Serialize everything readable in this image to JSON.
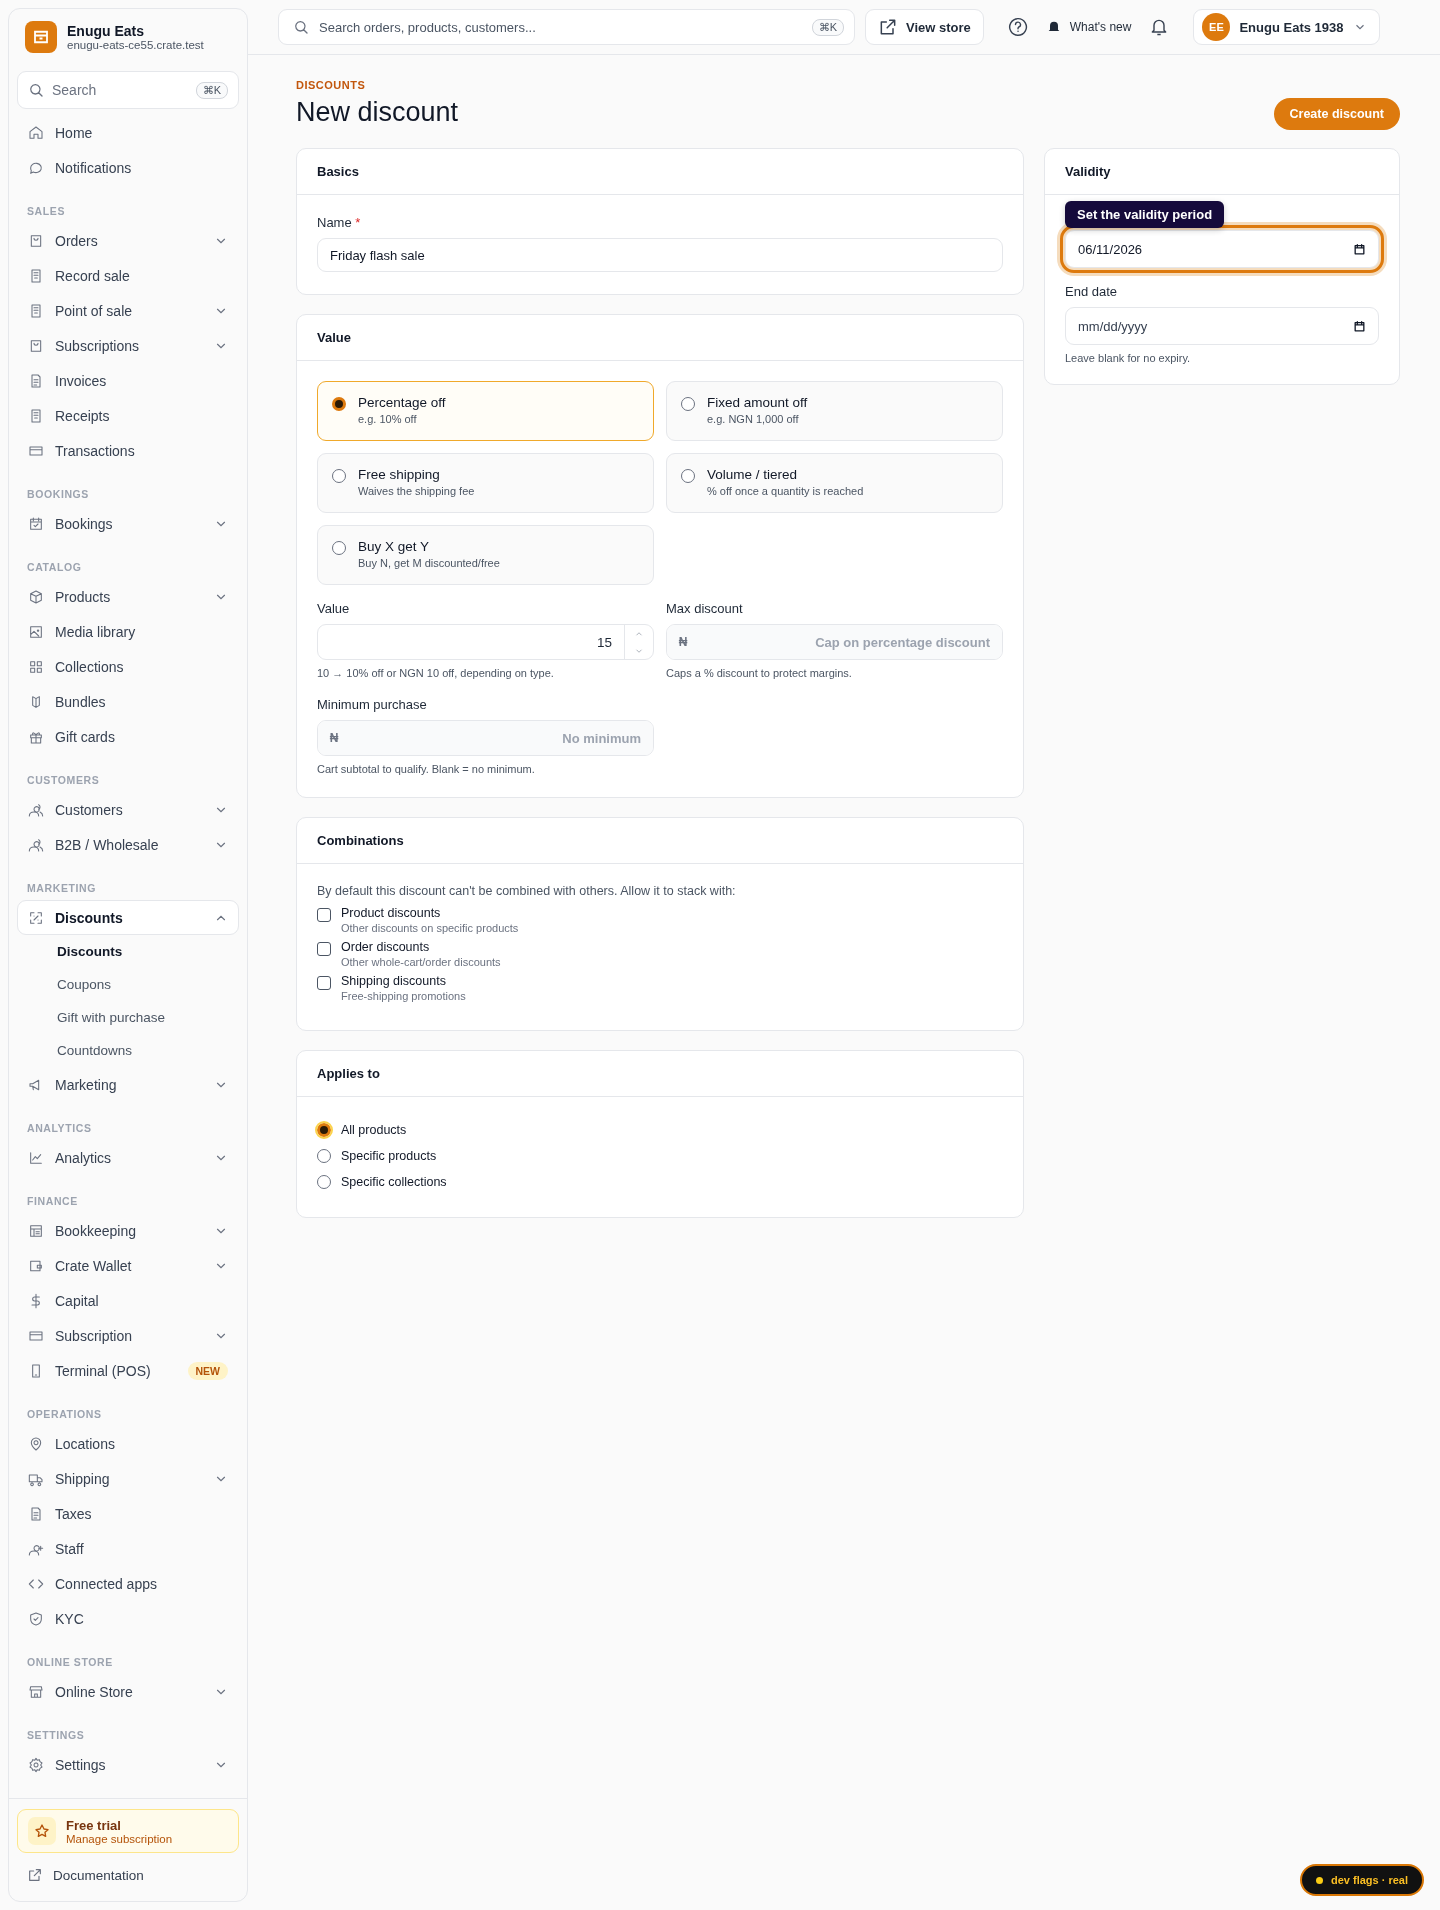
{
  "brand": {
    "name": "Enugu Eats",
    "domain": "enugu-eats-ce55.crate.test"
  },
  "sidebar": {
    "search": {
      "placeholder": "Search",
      "shortcut": "⌘K"
    },
    "sections": [
      {
        "items": [
          {
            "label": "Home",
            "kind": "link",
            "selected": false
          },
          {
            "label": "Notifications",
            "kind": "link",
            "selected": false
          }
        ]
      },
      {
        "title": "SALES",
        "items": [
          {
            "label": "Orders",
            "kind": "group",
            "expanded": false,
            "selected": false
          },
          {
            "label": "Record sale",
            "kind": "link",
            "selected": false
          },
          {
            "label": "Point of sale",
            "kind": "group",
            "expanded": false,
            "selected": false
          },
          {
            "label": "Subscriptions",
            "kind": "group",
            "expanded": false,
            "selected": false
          },
          {
            "label": "Invoices",
            "kind": "link",
            "selected": false
          },
          {
            "label": "Receipts",
            "kind": "link",
            "selected": false
          },
          {
            "label": "Transactions",
            "kind": "link",
            "selected": false
          }
        ]
      },
      {
        "title": "BOOKINGS",
        "items": [
          {
            "label": "Bookings",
            "kind": "group",
            "expanded": false,
            "selected": false
          }
        ]
      },
      {
        "title": "CATALOG",
        "items": [
          {
            "label": "Products",
            "kind": "group",
            "expanded": false,
            "selected": false
          },
          {
            "label": "Media library",
            "kind": "link",
            "selected": false
          },
          {
            "label": "Collections",
            "kind": "link",
            "selected": false
          },
          {
            "label": "Bundles",
            "kind": "link",
            "selected": false
          },
          {
            "label": "Gift cards",
            "kind": "link",
            "selected": false
          }
        ]
      },
      {
        "title": "CUSTOMERS",
        "items": [
          {
            "label": "Customers",
            "kind": "group",
            "expanded": false,
            "selected": false
          },
          {
            "label": "B2B / Wholesale",
            "kind": "group",
            "expanded": false,
            "selected": false
          }
        ]
      },
      {
        "title": "MARKETING",
        "items": [
          {
            "label": "Discounts",
            "kind": "group",
            "expanded": true,
            "selected": true,
            "children": [
              {
                "label": "Discounts",
                "selected": true
              },
              {
                "label": "Coupons",
                "selected": false
              },
              {
                "label": "Gift with purchase",
                "selected": false
              },
              {
                "label": "Countdowns",
                "selected": false
              }
            ]
          },
          {
            "label": "Marketing",
            "kind": "group",
            "expanded": false,
            "selected": false
          }
        ]
      },
      {
        "title": "ANALYTICS",
        "items": [
          {
            "label": "Analytics",
            "kind": "group",
            "expanded": false,
            "selected": false
          }
        ]
      },
      {
        "title": "FINANCE",
        "items": [
          {
            "label": "Bookkeeping",
            "kind": "group",
            "expanded": false,
            "selected": false
          },
          {
            "label": "Crate Wallet",
            "kind": "group",
            "expanded": false,
            "selected": false
          },
          {
            "label": "Capital",
            "kind": "link",
            "selected": false
          },
          {
            "label": "Subscription",
            "kind": "group",
            "expanded": false,
            "selected": false
          },
          {
            "label": "Terminal (POS)",
            "kind": "link",
            "selected": false,
            "badge": "NEW"
          }
        ]
      },
      {
        "title": "OPERATIONS",
        "items": [
          {
            "label": "Locations",
            "kind": "link",
            "selected": false
          },
          {
            "label": "Shipping",
            "kind": "group",
            "expanded": false,
            "selected": false
          },
          {
            "label": "Taxes",
            "kind": "link",
            "selected": false
          },
          {
            "label": "Staff",
            "kind": "link",
            "selected": false
          },
          {
            "label": "Connected apps",
            "kind": "link",
            "selected": false
          },
          {
            "label": "KYC",
            "kind": "link",
            "selected": false
          }
        ]
      },
      {
        "title": "ONLINE STORE",
        "items": [
          {
            "label": "Online Store",
            "kind": "group",
            "expanded": false,
            "selected": false
          }
        ]
      },
      {
        "title": "SETTINGS",
        "items": [
          {
            "label": "Settings",
            "kind": "group",
            "expanded": false,
            "selected": false
          }
        ]
      }
    ],
    "trial": {
      "title": "Free trial",
      "subtitle": "Manage subscription"
    },
    "documentation": "Documentation"
  },
  "topbar": {
    "search": {
      "placeholder": "Search orders, products, customers...",
      "shortcut": "⌘K"
    },
    "view_store": "View store",
    "whats_new": "What's new",
    "account": {
      "initials": "EE",
      "name": "Enugu Eats 1938"
    }
  },
  "page": {
    "eyebrow": "DISCOUNTS",
    "title": "New discount",
    "primary_action": "Create discount",
    "basics": {
      "title": "Basics",
      "name_label": "Name",
      "required_mark": "*",
      "name_value": "Friday flash sale"
    },
    "value": {
      "title": "Value",
      "options": [
        {
          "title": "Percentage off",
          "hint": "e.g. 10% off",
          "selected": true
        },
        {
          "title": "Fixed amount off",
          "hint": "e.g. NGN 1,000 off",
          "selected": false
        },
        {
          "title": "Free shipping",
          "hint": "Waives the shipping fee",
          "selected": false
        },
        {
          "title": "Volume / tiered",
          "hint": "% off once a quantity is reached",
          "selected": false
        },
        {
          "title": "Buy X get Y",
          "hint": "Buy N, get M discounted/free",
          "selected": false
        }
      ],
      "value_label": "Value",
      "value": "15",
      "value_help": "10 → 10% off or NGN 10 off, depending on type.",
      "max_label": "Max discount",
      "currency": "₦",
      "max_placeholder": "Cap on percentage discount",
      "max_help": "Caps a % discount to protect margins.",
      "min_label": "Minimum purchase",
      "min_currency": "₦",
      "min_placeholder": "No minimum",
      "min_help": "Cart subtotal to qualify. Blank = no minimum."
    },
    "combinations": {
      "title": "Combinations",
      "intro": "By default this discount can't be combined with others. Allow it to stack with:",
      "options": [
        {
          "title": "Product discounts",
          "hint": "Other discounts on specific products",
          "checked": false
        },
        {
          "title": "Order discounts",
          "hint": "Other whole-cart/order discounts",
          "checked": false
        },
        {
          "title": "Shipping discounts",
          "hint": "Free-shipping promotions",
          "checked": false
        }
      ]
    },
    "applies_to": {
      "title": "Applies to",
      "options": [
        {
          "label": "All products",
          "selected": true
        },
        {
          "label": "Specific products",
          "selected": false
        },
        {
          "label": "Specific collections",
          "selected": false
        }
      ]
    },
    "validity": {
      "title": "Validity",
      "tooltip": "Set the validity period",
      "start_value": "06/11/2026",
      "start_focused": true,
      "end_label": "End date",
      "end_placeholder": "mm/dd/yyyy",
      "end_help": "Leave blank for no expiry."
    }
  },
  "dev_flags": "dev flags · real"
}
